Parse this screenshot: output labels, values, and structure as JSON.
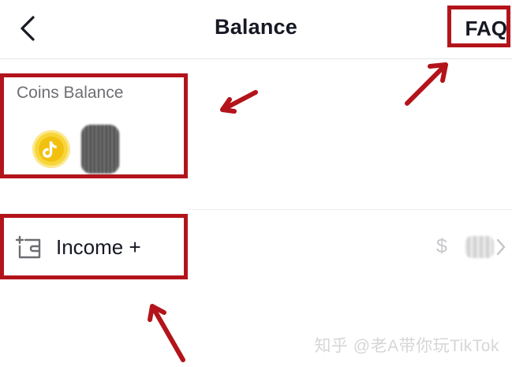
{
  "header": {
    "title": "Balance",
    "faq_label": "FAQ"
  },
  "coins": {
    "label": "Coins Balance"
  },
  "income": {
    "label": "Income +",
    "value_prefix": "$"
  },
  "watermark": "知乎 @老A带你玩TikTok",
  "colors": {
    "annotation": "#b3141b",
    "coin": "#f8d63a",
    "text": "#161823",
    "muted": "#6e6e73"
  },
  "icons": {
    "back": "chevron-left-icon",
    "coin": "tiktok-coin-icon",
    "wallet": "wallet-plus-icon",
    "chevron": "chevron-right-icon"
  }
}
